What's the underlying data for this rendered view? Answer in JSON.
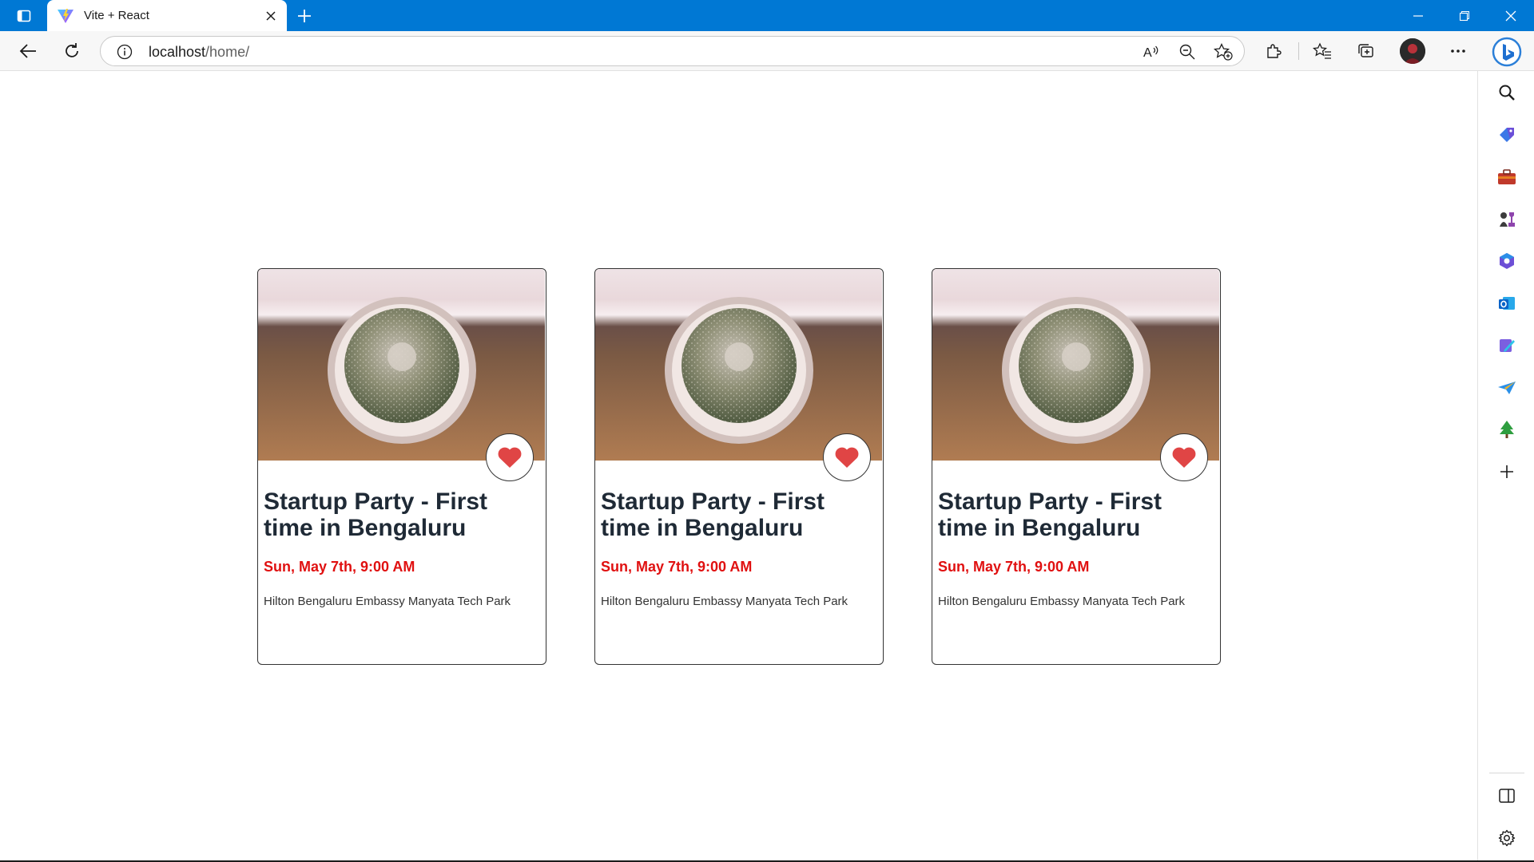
{
  "browser": {
    "tab_title": "Vite + React",
    "url_host": "localhost",
    "url_path": "/home/"
  },
  "events": [
    {
      "title": "Startup Party - First time in Bengaluru",
      "date": "Sun, May 7th, 9:00 AM",
      "venue": "Hilton Bengaluru Embassy Manyata Tech Park",
      "image": "cactus-photo",
      "favorite": true
    },
    {
      "title": "Startup Party - First time in Bengaluru",
      "date": "Sun, May 7th, 9:00 AM",
      "venue": "Hilton Bengaluru Embassy Manyata Tech Park",
      "image": "cactus-photo",
      "favorite": true
    },
    {
      "title": "Startup Party - First time in Bengaluru",
      "date": "Sun, May 7th, 9:00 AM",
      "venue": "Hilton Bengaluru Embassy Manyata Tech Park",
      "image": "cactus-photo",
      "favorite": true
    }
  ],
  "colors": {
    "titlebar": "#0078d4",
    "date_text": "#e01010",
    "heart": "#e04545",
    "title_text": "#1f2a36"
  }
}
